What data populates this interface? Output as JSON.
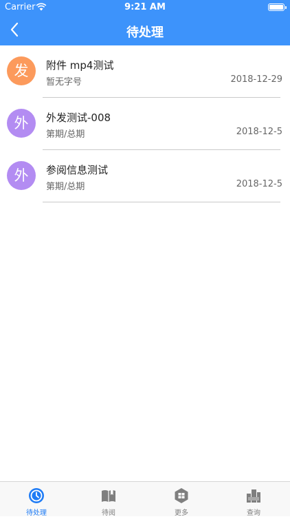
{
  "status_bar": {
    "carrier": "Carrier",
    "time": "9:21 AM"
  },
  "nav": {
    "title": "待处理",
    "back_icon": "chevron-left-icon"
  },
  "items": [
    {
      "badge": "发",
      "badge_color": "#fc9a5c",
      "title": "附件 mp4测试",
      "subtitle": "暂无字号",
      "date": "2018-12-29"
    },
    {
      "badge": "外",
      "badge_color": "#b38cf2",
      "title": "外发测试-008",
      "subtitle": "第期/总期",
      "date": "2018-12-5"
    },
    {
      "badge": "外",
      "badge_color": "#b38cf2",
      "title": "参阅信息测试",
      "subtitle": "第期/总期",
      "date": "2018-12-5"
    }
  ],
  "tabs": [
    {
      "label": "待处理",
      "icon": "clock-icon",
      "active": true
    },
    {
      "label": "待阅",
      "icon": "book-icon",
      "active": false
    },
    {
      "label": "更多",
      "icon": "grid-hexagon-icon",
      "active": false
    },
    {
      "label": "查询",
      "icon": "search-building-icon",
      "active": false
    }
  ],
  "colors": {
    "nav_bg": "#3d93fb",
    "tab_active": "#1f7cf5",
    "tab_inactive": "#7f7f7f"
  }
}
